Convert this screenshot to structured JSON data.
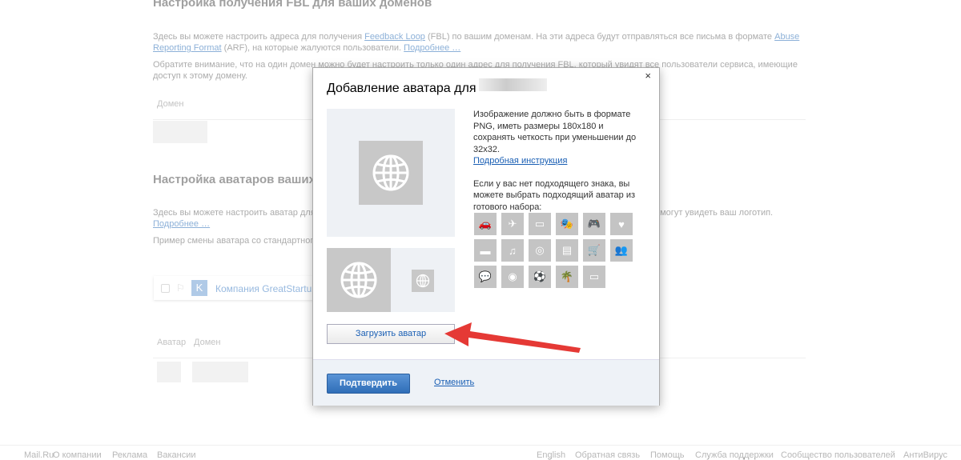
{
  "background": {
    "fbl_title": "Настройка получения FBL для ваших доменов",
    "fbl_p1_part1": "Здесь вы можете настроить адреса для получения ",
    "fbl_p1_link1": "Feedback Loop",
    "fbl_p1_part2": " (FBL) по вашим доменам. На эти адреса будут отправляться все письма в формате ",
    "fbl_p1_link2": "Abuse Reporting Format",
    "fbl_p1_part3": " (ARF), на которые жалуются пользователи. ",
    "fbl_p1_more": "Подробнее …",
    "fbl_p2": "Обратите внимание, что на один домен можно будет настроить только один адрес для получения FBL, который увидят все пользователи сервиса, имеющие доступ к этому домену.",
    "fbl_col_domain": "Домен",
    "avatars_title": "Настройка аватаров ваших доменов",
    "avatars_p1": "Здесь вы можете настроить аватар для ваших доменов. Тогда пользователи вместо стандартной буквы на месте аватара смогут увидеть ваш логотип. ",
    "avatars_more": "Подробнее …",
    "avatars_p2": "Пример смены аватара со стандартного",
    "example_letter": "K",
    "example_name": "Компания GreatStartup",
    "col_avatar": "Аватар",
    "col_domain": "Домен"
  },
  "modal": {
    "title": "Добавление аватара для",
    "close": "×",
    "info_text": "Изображение должно быть в формате PNG, иметь размеры 180x180 и сохранять четкость при уменьшении до 32x32.",
    "instruction_link": "Подробная инструкция",
    "preset_text": "Если у вас нет подходящего знака, вы можете выбрать подходящий аватар из готового набора:",
    "upload_button": "Загрузить аватар",
    "confirm_button": "Подтвердить",
    "cancel_link": "Отменить",
    "preset_icons": [
      "car-icon",
      "plane-icon",
      "printer-icon",
      "theater-masks-icon",
      "gamepad-icon",
      "heart-icon",
      "credit-card-icon",
      "music-note-icon",
      "globe-icon",
      "store-icon",
      "cart-icon",
      "people-icon",
      "chat-bubbles-icon",
      "disc-icon",
      "soccer-ball-icon",
      "palm-island-icon",
      "monitor-icon"
    ],
    "preset_glyphs": [
      "🚗",
      "✈",
      "▭",
      "🎭",
      "🎮",
      "♥",
      "▬",
      "♫",
      "◎",
      "▤",
      "🛒",
      "👥",
      "💬",
      "◉",
      "⚽",
      "🌴",
      "▭"
    ]
  },
  "footer": {
    "left": [
      "Mail.Ru",
      "О компании",
      "Реклама",
      "Вакансии"
    ],
    "right": [
      "English",
      "Обратная связь",
      "Помощь",
      "Служба поддержки",
      "Сообщество пользователей",
      "АнтиВирус"
    ]
  },
  "colors": {
    "accent": "#2f6eb8",
    "arrow": "#e53935",
    "link": "#1a5fb4"
  }
}
